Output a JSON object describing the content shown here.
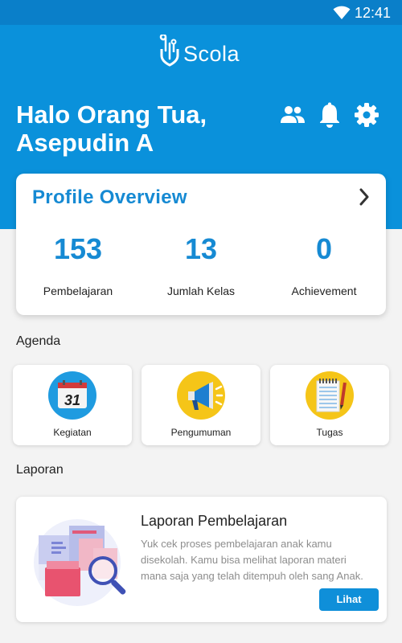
{
  "status_bar": {
    "time": "12:41",
    "wifi_icon": "wifi-icon"
  },
  "header": {
    "app_name": "Scola",
    "greeting_line1": "Halo Orang Tua,",
    "greeting_line2": "Asepudin A",
    "icons": [
      "people-icon",
      "bell-icon",
      "gear-icon"
    ]
  },
  "profile_overview": {
    "title": "Profile Overview",
    "stats": [
      {
        "value": "153",
        "label": "Pembelajaran"
      },
      {
        "value": "13",
        "label": "Jumlah Kelas"
      },
      {
        "value": "0",
        "label": "Achievement"
      }
    ]
  },
  "agenda": {
    "section_label": "Agenda",
    "items": [
      {
        "label": "Kegiatan",
        "icon": "calendar-icon",
        "calendar_number": "31"
      },
      {
        "label": "Pengumuman",
        "icon": "megaphone-icon"
      },
      {
        "label": "Tugas",
        "icon": "notebook-icon"
      }
    ]
  },
  "laporan": {
    "section_label": "Laporan",
    "card": {
      "title": "Laporan Pembelajaran",
      "description": "Yuk cek proses pembelajaran anak kamu disekolah. Kamu bisa melihat laporan materi mana saja yang telah ditempuh oleh sang Anak.",
      "button_label": "Lihat"
    }
  },
  "colors": {
    "primary": "#0a91db",
    "status_bar": "#0a7fc9",
    "accent_text": "#168ad3",
    "background": "#f3f3f3"
  }
}
